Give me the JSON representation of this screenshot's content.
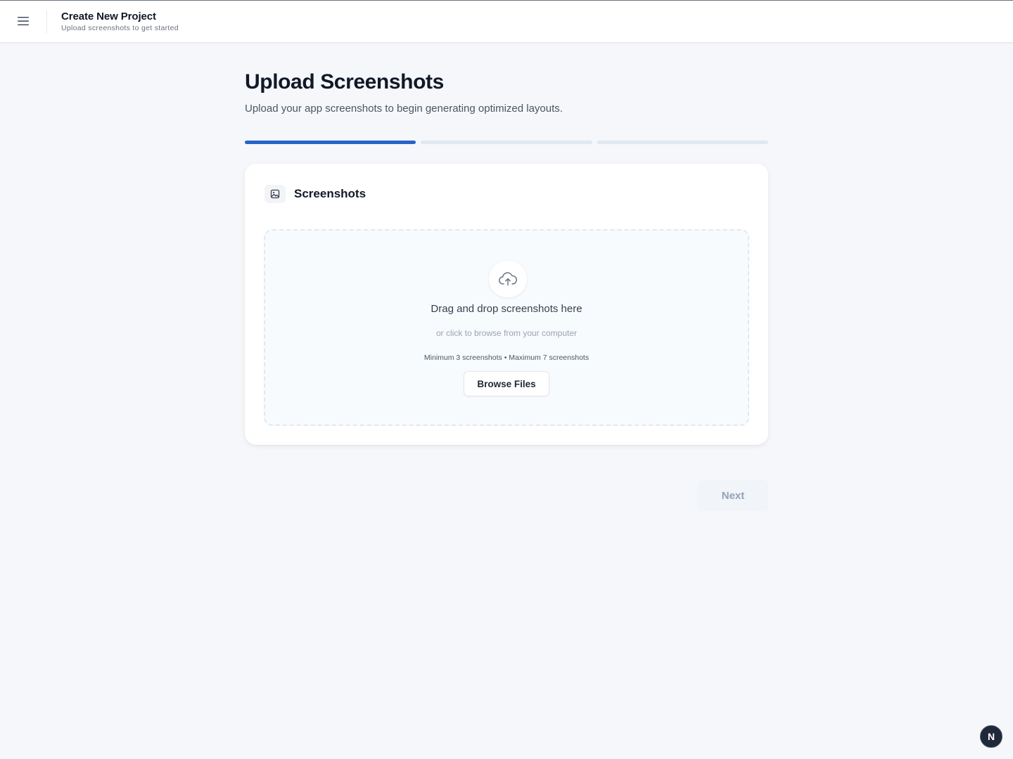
{
  "header": {
    "menu_icon": "hamburger-menu-icon",
    "title": "Create New Project",
    "subtitle": "Upload screenshots to get started"
  },
  "page": {
    "title": "Upload Screenshots",
    "description": "Upload your app screenshots to begin generating optimized layouts."
  },
  "progress": {
    "current_step": 1,
    "total_steps": 3,
    "active_color": "#2563c9",
    "inactive_color": "#e2e8f0"
  },
  "card": {
    "icon": "image-icon",
    "title": "Screenshots"
  },
  "dropzone": {
    "icon": "cloud-upload-icon",
    "title": "Drag and drop screenshots here",
    "subtitle": "or click to browse from your computer",
    "limits": "Minimum 3 screenshots • Maximum 7 screenshots",
    "browse_label": "Browse Files"
  },
  "footer": {
    "next_label": "Next",
    "next_enabled": false
  },
  "dev_badge": {
    "label": "N"
  }
}
